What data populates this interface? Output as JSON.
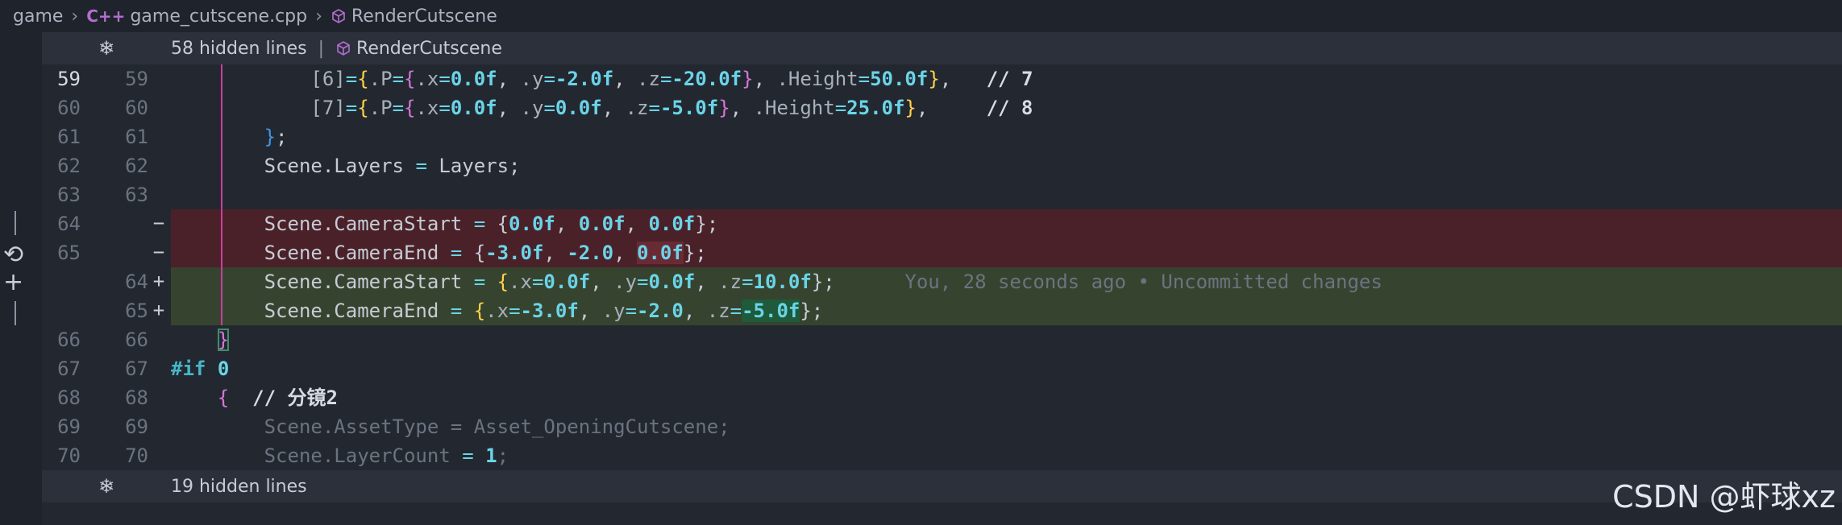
{
  "breadcrumb": {
    "root": "game",
    "file": "game_cutscene.cpp",
    "file_icon": "C++",
    "symbol": "RenderCutscene"
  },
  "fold_top": {
    "hidden": "58 hidden lines",
    "separator": "|",
    "symbol": "RenderCutscene"
  },
  "fold_bottom": {
    "hidden": "19 hidden lines"
  },
  "line_numbers": [
    {
      "old": "59",
      "new": "59",
      "mark": ""
    },
    {
      "old": "60",
      "new": "60",
      "mark": ""
    },
    {
      "old": "61",
      "new": "61",
      "mark": ""
    },
    {
      "old": "62",
      "new": "62",
      "mark": ""
    },
    {
      "old": "63",
      "new": "63",
      "mark": ""
    },
    {
      "old": "64",
      "new": "",
      "mark": "−"
    },
    {
      "old": "65",
      "new": "",
      "mark": "−"
    },
    {
      "old": "",
      "new": "64",
      "mark": "+"
    },
    {
      "old": "",
      "new": "65",
      "mark": "+"
    },
    {
      "old": "66",
      "new": "66",
      "mark": ""
    },
    {
      "old": "67",
      "new": "67",
      "mark": ""
    },
    {
      "old": "68",
      "new": "68",
      "mark": ""
    },
    {
      "old": "69",
      "new": "69",
      "mark": ""
    },
    {
      "old": "70",
      "new": "70",
      "mark": ""
    }
  ],
  "code": {
    "l59": {
      "indent": "            ",
      "idx": "[6]",
      "eq": "=",
      "b1": "{",
      "p": ".P",
      "eq2": "=",
      "b2": "{",
      "x": ".x",
      "xv": "0.0f",
      "y": ".y",
      "yv": "-2.0f",
      "z": ".z",
      "zv": "-20.0f",
      "b2c": "}",
      "h": ".Height",
      "hv": "50.0f",
      "b1c": "}",
      "comma": ",",
      "cmt": "// 7"
    },
    "l60": {
      "indent": "            ",
      "idx": "[7]",
      "eq": "=",
      "b1": "{",
      "p": ".P",
      "eq2": "=",
      "b2": "{",
      "x": ".x",
      "xv": "0.0f",
      "y": ".y",
      "yv": "0.0f",
      "z": ".z",
      "zv": "-5.0f",
      "b2c": "}",
      "h": ".Height",
      "hv": "25.0f",
      "b1c": "}",
      "comma": ",",
      "cmt": "// 8"
    },
    "l61": {
      "indent": "        ",
      "brace": "}",
      "semi": ";"
    },
    "l62": {
      "indent": "        ",
      "lhs": "Scene.Layers",
      "op": "=",
      "rhs": "Layers;"
    },
    "l64old": {
      "indent": "        ",
      "lhs": "Scene.CameraStart",
      "op": "=",
      "open": "{",
      "v1": "0.0f",
      "v2": "0.0f",
      "v3": "0.0f",
      "close": "};"
    },
    "l65old": {
      "indent": "        ",
      "lhs": "Scene.CameraEnd",
      "op": "=",
      "open": "{",
      "v1": "-3.0f",
      "v2": "-2.0",
      "v3": "0.0f",
      "close": "};"
    },
    "l64new": {
      "indent": "        ",
      "lhs": "Scene.CameraStart",
      "op": "=",
      "open": "{",
      "x": ".x",
      "xv": "0.0f",
      "y": ".y",
      "yv": "0.0f",
      "z": ".z",
      "zv": "10.0f",
      "close": "};",
      "blame": "You, 28 seconds ago • Uncommitted changes"
    },
    "l65new": {
      "indent": "        ",
      "lhs": "Scene.CameraEnd",
      "op": "=",
      "open": "{",
      "x": ".x",
      "xv": "-3.0f",
      "y": ".y",
      "yv": "-2.0",
      "z": ".z",
      "zv": "-5.0f",
      "close": "};"
    },
    "l66": {
      "indent": "    ",
      "brace": "}"
    },
    "l67": {
      "kw": "#if",
      "val": "0"
    },
    "l68": {
      "indent": "    ",
      "brace": "{",
      "cmt": "// 分镜2"
    },
    "l69": {
      "indent": "        ",
      "lhs": "Scene.AssetType",
      "op": "=",
      "rhs": "Asset_OpeningCutscene;"
    },
    "l70": {
      "indent": "        ",
      "lhs": "Scene.LayerCount",
      "op": "=",
      "rhs": "1",
      "semi": ";"
    }
  },
  "watermark": "CSDN @虾球xz",
  "colors": {
    "removed_bg": "#4a2128",
    "added_bg": "#36442f",
    "accent_guide": "#c93e9e"
  },
  "icons": [
    "chevron-right-icon",
    "cpp-file-icon",
    "symbol-method-icon",
    "fold-snowflake-icon",
    "revert-icon",
    "plus-icon"
  ]
}
